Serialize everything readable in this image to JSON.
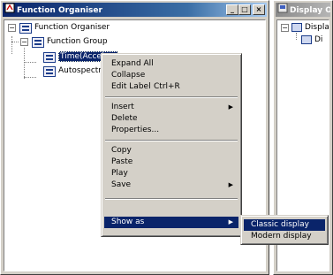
{
  "left_window": {
    "title": "Function Organiser",
    "buttons": [
      "_",
      "□",
      "×"
    ]
  },
  "right_window": {
    "title": "Display O",
    "tree": [
      {
        "label": "Display"
      },
      {
        "label": "Di"
      }
    ]
  },
  "tree": {
    "root": {
      "label": "Function Organiser",
      "expander": "−"
    },
    "group": {
      "label": "Function Group",
      "expander": "−"
    },
    "items": [
      {
        "label": "Time(Accelero"
      },
      {
        "label": "Autospectrum("
      }
    ]
  },
  "context_menu": {
    "items": [
      {
        "label": "Expand All"
      },
      {
        "label": "Collapse"
      },
      {
        "label": "Edit Label",
        "shortcut": "Ctrl+R"
      },
      {
        "label": "Insert",
        "arrow": "▶"
      },
      {
        "label": "Delete"
      },
      {
        "label": "Properties..."
      },
      {
        "label": "Copy"
      },
      {
        "label": "Paste"
      },
      {
        "label": "Play"
      },
      {
        "label": "Save",
        "arrow": "▶"
      },
      {
        "label": "Show as",
        "arrow": "▶"
      }
    ]
  },
  "submenu": {
    "items": [
      {
        "label": "Classic display"
      },
      {
        "label": "Modern display"
      }
    ]
  },
  "colors": {
    "highlight": "#0a246a",
    "face": "#d4d0c8"
  }
}
